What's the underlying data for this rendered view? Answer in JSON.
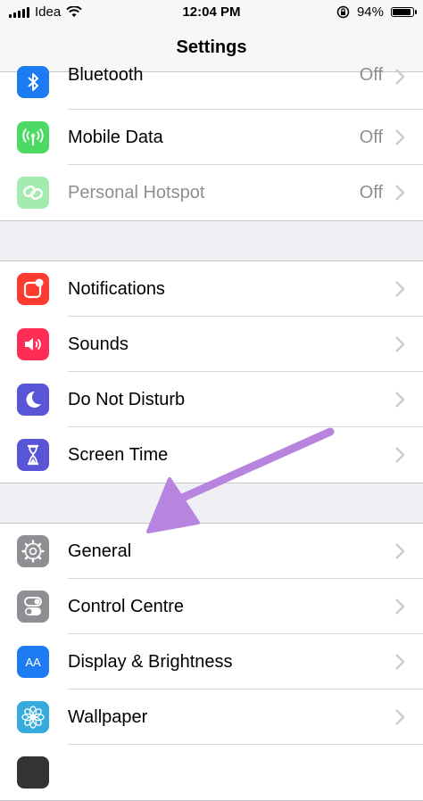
{
  "status_bar": {
    "carrier": "Idea",
    "time": "12:04 PM",
    "battery": "94%",
    "battery_level": 0.94
  },
  "nav": {
    "title": "Settings"
  },
  "groups": [
    {
      "rows": [
        {
          "label": "Bluetooth",
          "value": "Off",
          "icon": "bluetooth-icon",
          "color": "#1e7cf2"
        },
        {
          "label": "Mobile Data",
          "value": "Off",
          "icon": "antenna-icon",
          "color": "#4cd964"
        },
        {
          "label": "Personal Hotspot",
          "value": "Off",
          "icon": "hotspot-icon",
          "color": "#4cd964"
        }
      ]
    },
    {
      "rows": [
        {
          "label": "Notifications",
          "icon": "notifications-icon",
          "color": "#ff3b30"
        },
        {
          "label": "Sounds",
          "icon": "speaker-icon",
          "color": "#ff2d55"
        },
        {
          "label": "Do Not Disturb",
          "icon": "moon-icon",
          "color": "#5856d6"
        },
        {
          "label": "Screen Time",
          "icon": "hourglass-icon",
          "color": "#5856d6"
        }
      ]
    },
    {
      "rows": [
        {
          "label": "General",
          "icon": "gear-icon",
          "color": "#8e8e93"
        },
        {
          "label": "Control Centre",
          "icon": "toggles-icon",
          "color": "#8e8e93"
        },
        {
          "label": "Display & Brightness",
          "icon": "text-size-icon",
          "color": "#1e7cf2",
          "icon_text": "AA"
        },
        {
          "label": "Wallpaper",
          "icon": "flower-icon",
          "color": "#35aadc"
        }
      ]
    }
  ],
  "annotation": {
    "type": "arrow",
    "color": "#b784e0",
    "points_to": "General"
  }
}
